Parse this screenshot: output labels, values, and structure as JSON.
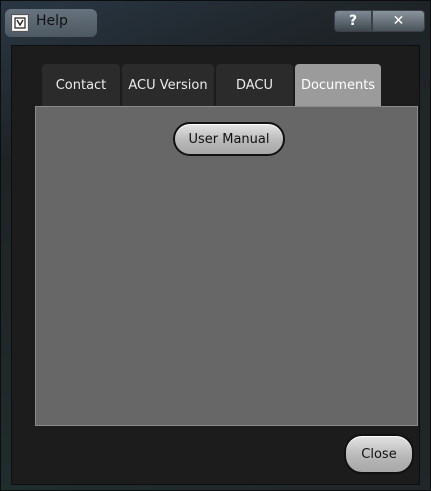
{
  "window": {
    "title": "Help",
    "icon": "app-icon"
  },
  "caption_buttons": {
    "help_label": "?",
    "close_label": "✕"
  },
  "tabs": [
    {
      "label": "Contact",
      "active": false
    },
    {
      "label": "ACU Version",
      "active": false
    },
    {
      "label": "DACU",
      "active": false
    },
    {
      "label": "Documents",
      "active": true
    }
  ],
  "documents": {
    "user_manual_label": "User Manual"
  },
  "footer": {
    "close_label": "Close"
  },
  "colors": {
    "active_tab": "#9b9b9b",
    "panel": "#676767",
    "dialog_bg": "#1c1c1c"
  }
}
